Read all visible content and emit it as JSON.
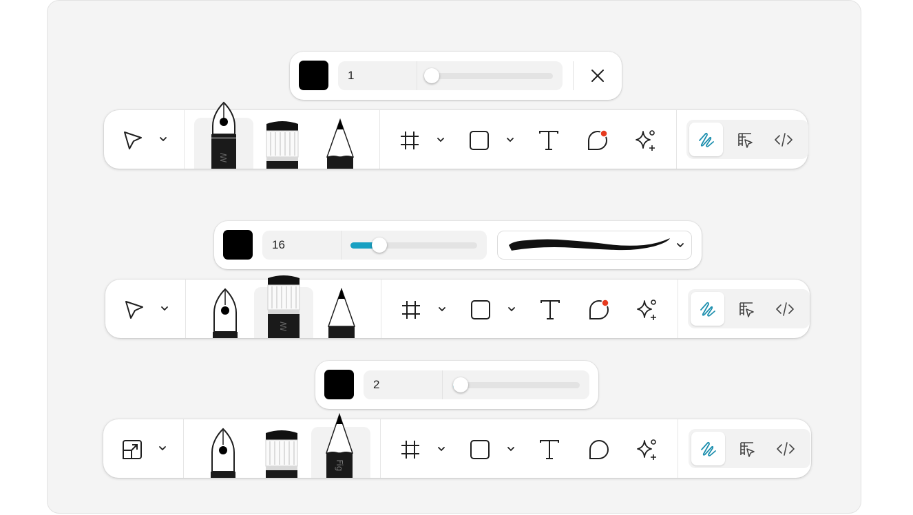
{
  "variants": [
    {
      "stroke_width": "1",
      "slider_level": 0.0,
      "color": "#000000",
      "selected_drawing_tool": "pen",
      "leading_tool_icon": "move-pointer-icon",
      "comment_indicator_color": "#e63a1f"
    },
    {
      "stroke_width": "16",
      "slider_level": 0.22,
      "color": "#000000",
      "selected_drawing_tool": "marker",
      "brush_preset_icon": "brush-stroke-preview",
      "leading_tool_icon": "move-pointer-icon",
      "comment_indicator_color": "#e63a1f"
    },
    {
      "stroke_width": "2",
      "slider_level": 0.02,
      "color": "#000000",
      "selected_drawing_tool": "pencil",
      "leading_tool_icon": "resize-frame-icon"
    }
  ],
  "pen_engraving": "ꟿ",
  "pencil_engraving": "Fig",
  "colors": {
    "accent": "#18a0c2",
    "mode_active": "#1d8fae",
    "notification": "#e63a1f"
  }
}
